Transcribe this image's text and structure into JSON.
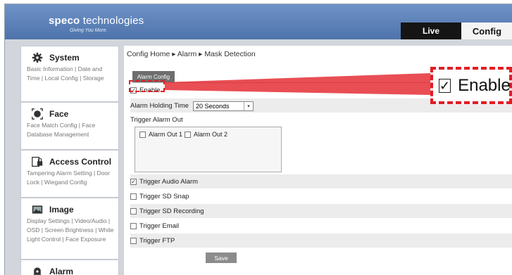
{
  "header": {
    "logo_brand": "speco",
    "logo_rest": " technologies",
    "logo_tagline": "Giving You More.",
    "tabs": [
      {
        "label": "Live"
      },
      {
        "label": "Config"
      }
    ]
  },
  "sidebar": {
    "sections": [
      {
        "title": "System",
        "icon": "gear-icon",
        "links": "Basic Information | Date and Time | Local Config | Storage"
      },
      {
        "title": "Face",
        "icon": "face-icon",
        "links": "Face Match Config | Face Database Management"
      },
      {
        "title": "Access Control",
        "icon": "access-control-icon",
        "links": "Tampering Alarm Setting | Door Lock | Wiegand Config"
      },
      {
        "title": "Image",
        "icon": "image-icon",
        "links": "Display Settings | Video/Audio | OSD | Screen Brightness | White Light Control | Face Exposure"
      },
      {
        "title": "Alarm",
        "icon": "alarm-icon",
        "links": ""
      }
    ]
  },
  "main": {
    "breadcrumb": "Config Home ▸ Alarm ▸ Mask Detection",
    "sub_tab": "Alarm Config",
    "enable_label": "Enable",
    "enable_checked": true,
    "holding_time_label": "Alarm Holding Time",
    "holding_time_value": "20 Seconds",
    "trigger_alarm_out_label": "Trigger Alarm Out",
    "alarm_out_1": "Alarm Out 1",
    "alarm_out_2": "Alarm Out 2",
    "triggers": [
      {
        "label": "Trigger Audio Alarm",
        "checked": true
      },
      {
        "label": "Trigger SD Snap",
        "checked": false
      },
      {
        "label": "Trigger SD Recording",
        "checked": false
      },
      {
        "label": "Trigger Email",
        "checked": false
      },
      {
        "label": "Trigger FTP",
        "checked": false
      }
    ],
    "save_label": "Save"
  },
  "callout": {
    "label": "Enable",
    "checked": true,
    "color": "#e21c24"
  }
}
